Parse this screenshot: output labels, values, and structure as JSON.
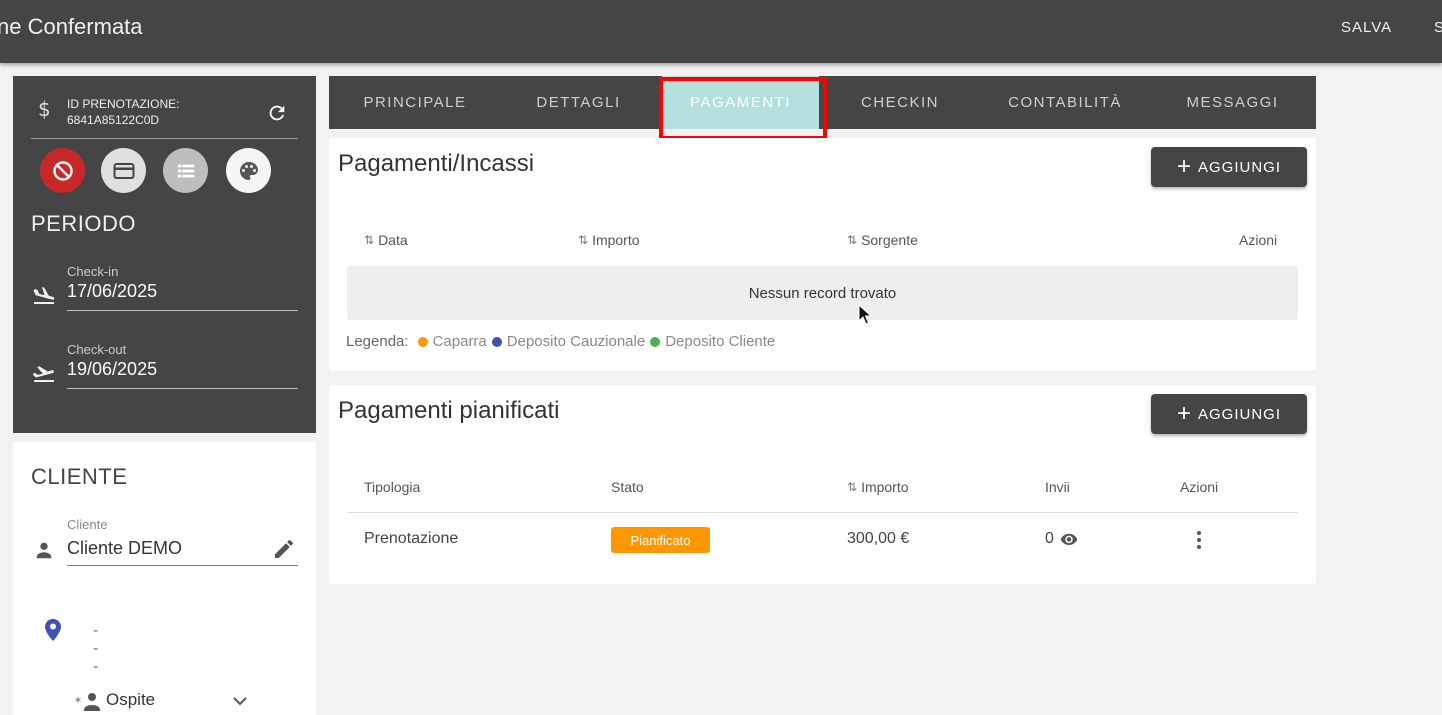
{
  "header": {
    "title": "ne Confermata",
    "save_label": "SALVA",
    "overflow_label": "S"
  },
  "sidebar": {
    "id_label": "ID PRENOTAZIONE:",
    "id_value": "6841A85122C0D",
    "periodo_label": "PERIODO",
    "checkin_label": "Check-in",
    "checkin_value": "17/06/2025",
    "checkout_label": "Check-out",
    "checkout_value": "19/06/2025",
    "cliente_heading": "CLIENTE",
    "cliente_label": "Cliente",
    "cliente_value": "Cliente DEMO",
    "location_value": "---",
    "ospite_label": "Ospite",
    "action_icons": [
      "block-icon",
      "credit-card-icon",
      "list-icon",
      "palette-icon"
    ]
  },
  "tabs": [
    {
      "label": "PRINCIPALE",
      "active": false
    },
    {
      "label": "DETTAGLI",
      "active": false
    },
    {
      "label": "PAGAMENTI",
      "active": true
    },
    {
      "label": "CHECKIN",
      "active": false
    },
    {
      "label": "CONTABILITÀ",
      "active": false
    },
    {
      "label": "MESSAGGI",
      "active": false
    }
  ],
  "payments": {
    "title": "Pagamenti/Incassi",
    "add_label": "AGGIUNGI",
    "columns": {
      "data": "Data",
      "importo": "Importo",
      "sorgente": "Sorgente",
      "azioni": "Azioni"
    },
    "empty_text": "Nessun record trovato",
    "legend_label": "Legenda:",
    "legend": [
      {
        "label": "Caparra",
        "color": "#ff9800"
      },
      {
        "label": "Deposito Cauzionale",
        "color": "#3f51b5"
      },
      {
        "label": "Deposito Cliente",
        "color": "#4caf50"
      }
    ]
  },
  "scheduled": {
    "title": "Pagamenti pianificati",
    "add_label": "AGGIUNGI",
    "columns": {
      "tipologia": "Tipologia",
      "stato": "Stato",
      "importo": "Importo",
      "invii": "Invii",
      "azioni": "Azioni"
    },
    "rows": [
      {
        "tipologia": "Prenotazione",
        "stato": "Pianificato",
        "importo": "300,00 €",
        "invii": "0"
      }
    ]
  },
  "colors": {
    "dark": "#454545",
    "active_tab": "#b3e0dc",
    "status_badge": "#ff9800",
    "highlight": "#ff0000"
  }
}
